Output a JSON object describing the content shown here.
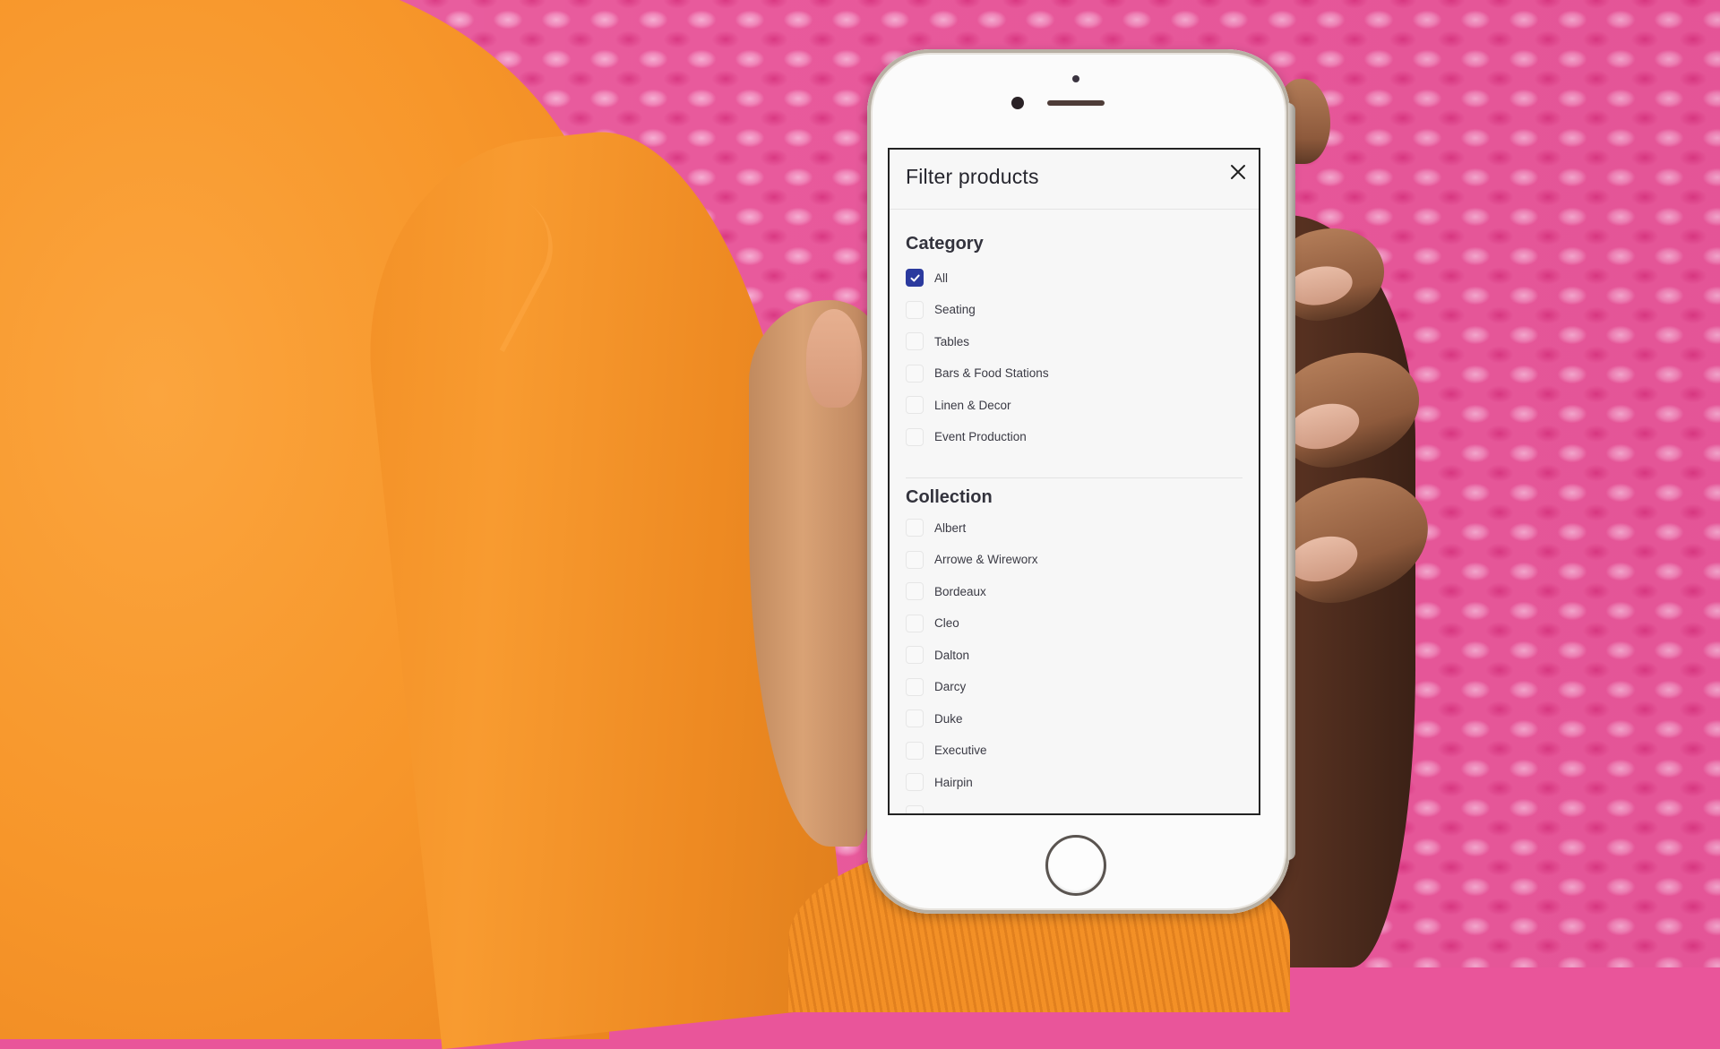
{
  "modal": {
    "title": "Filter products",
    "close_icon": "close-icon"
  },
  "sections": [
    {
      "title": "Category",
      "options": [
        {
          "label": "All",
          "checked": true
        },
        {
          "label": "Seating",
          "checked": false
        },
        {
          "label": "Tables",
          "checked": false
        },
        {
          "label": "Bars & Food Stations",
          "checked": false
        },
        {
          "label": "Linen & Decor",
          "checked": false
        },
        {
          "label": "Event Production",
          "checked": false
        }
      ]
    },
    {
      "title": "Collection",
      "options": [
        {
          "label": "Albert",
          "checked": false
        },
        {
          "label": "Arrowe & Wireworx",
          "checked": false
        },
        {
          "label": "Bordeaux",
          "checked": false
        },
        {
          "label": "Cleo",
          "checked": false
        },
        {
          "label": "Dalton",
          "checked": false
        },
        {
          "label": "Darcy",
          "checked": false
        },
        {
          "label": "Duke",
          "checked": false
        },
        {
          "label": "Executive",
          "checked": false
        },
        {
          "label": "Hairpin",
          "checked": false
        }
      ]
    }
  ],
  "colors": {
    "accent": "#2b3a9e",
    "background_pink": "#e85a9c",
    "sweater_orange": "#f7962a"
  }
}
